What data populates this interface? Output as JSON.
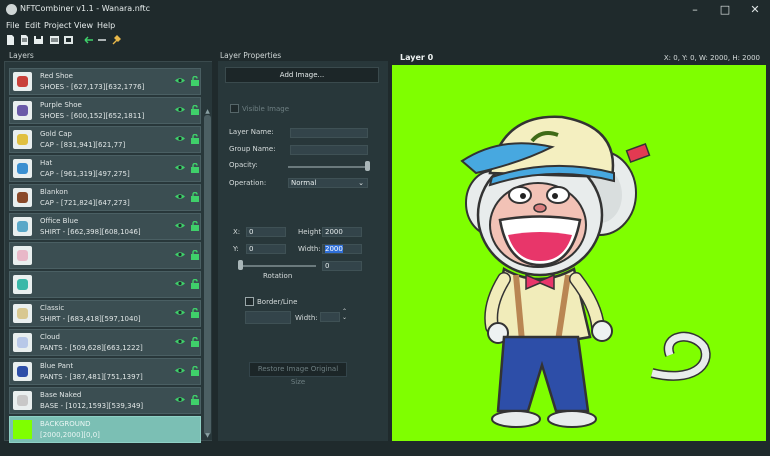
{
  "window": {
    "title": "NFTCombiner v1.1 - Wanara.nftc",
    "controls": [
      "minimize",
      "maximize",
      "close"
    ]
  },
  "menu": [
    "File",
    "Edit",
    "Project",
    "View",
    "Help"
  ],
  "toolbar": [
    "new-file",
    "open-file",
    "save-file",
    "save-all",
    "export",
    "arrow-left",
    "arrow-right",
    "settings"
  ],
  "panels": {
    "layers": "Layers",
    "properties": "Layer Properties"
  },
  "layers": [
    {
      "name": "Red Shoe",
      "meta": "SHOES - [627,173][632,1776]",
      "thumb": "shoe-red"
    },
    {
      "name": "Purple Shoe",
      "meta": "SHOES - [600,152][652,1811]",
      "thumb": "shoe-purple"
    },
    {
      "name": "Gold Cap",
      "meta": "CAP - [831,941][621,77]",
      "thumb": "cap-gold"
    },
    {
      "name": "Hat",
      "meta": "CAP - [961,319][497,275]",
      "thumb": "hat"
    },
    {
      "name": "Blankon",
      "meta": "CAP - [721,824][647,273]",
      "thumb": "blankon"
    },
    {
      "name": "Office Blue",
      "meta": "SHIRT - [662,398][608,1046]",
      "thumb": "shirt-blue"
    },
    {
      "name": "",
      "meta": "",
      "thumb": "shirt-pink"
    },
    {
      "name": "",
      "meta": "",
      "thumb": "shirt-teal"
    },
    {
      "name": "Classic",
      "meta": "SHIRT - [683,418][597,1040]",
      "thumb": "shirt-classic"
    },
    {
      "name": "Cloud",
      "meta": "PANTS - [509,628][663,1222]",
      "thumb": "pants-cloud"
    },
    {
      "name": "Blue Pant",
      "meta": "PANTS - [387,481][751,1397]",
      "thumb": "pants-blue"
    },
    {
      "name": "Base Naked",
      "meta": "BASE - [1012,1593][539,349]",
      "thumb": "base"
    },
    {
      "name": "BACKGROUND",
      "meta": "[2000,2000][0,0]",
      "thumb": "background",
      "selected": true,
      "color": "#7fff00"
    }
  ],
  "properties": {
    "add_image": "Add Image...",
    "visible_image": "Visible Image",
    "layer_name": "Layer Name:",
    "group_name": "Group Name:",
    "opacity": "Opacity:",
    "operation": "Operation:",
    "operation_value": "Normal",
    "x_label": "X:",
    "x_value": "0",
    "y_label": "Y:",
    "y_value": "0",
    "height_label": "Height",
    "height_value": "2000",
    "width_label": "Width:",
    "width_value": "2000",
    "rotation_label": "Rotation",
    "rotation_value": "0",
    "border_line": "Border/Line",
    "border_width_label": "Width:",
    "restore": "Restore Image Original Size"
  },
  "canvas": {
    "title": "Layer 0",
    "info": "X: 0, Y: 0, W: 2000, H: 2000",
    "background": "#7fff00"
  }
}
